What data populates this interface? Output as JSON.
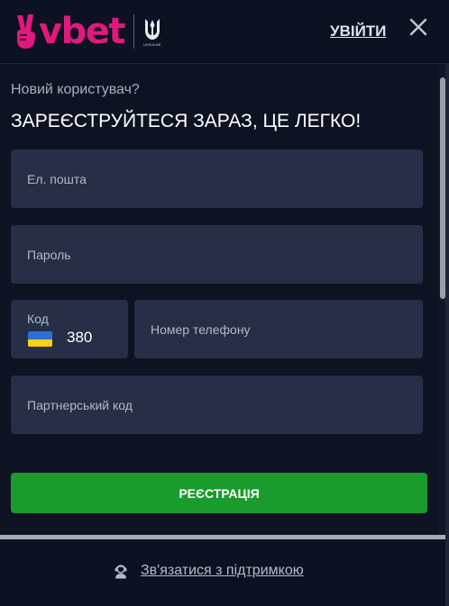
{
  "header": {
    "logo_text": "vbet",
    "crest_caption": "UKRAINE",
    "login_label": "УВІЙТИ",
    "close_icon": "close-icon"
  },
  "form": {
    "subtitle": "Новий користувач?",
    "title": "ЗАРЕЄСТРУЙТЕСЯ ЗАРАЗ, ЦЕ ЛЕГКО!",
    "email_placeholder": "Ел. пошта",
    "password_placeholder": "Пароль",
    "code_label": "Код",
    "code_value": "380",
    "phone_placeholder": "Номер телефону",
    "partner_placeholder": "Партнерський код",
    "submit_label": "РЕЄСТРАЦІЯ"
  },
  "footer": {
    "support_label": "Зв'язатися з підтримкою"
  },
  "colors": {
    "background": "#0d1322",
    "field": "#262f46",
    "brand_pink": "#e0197d",
    "submit_green": "#1a9b2d",
    "flag_blue": "#2f6fd6",
    "flag_yellow": "#f7d117"
  }
}
